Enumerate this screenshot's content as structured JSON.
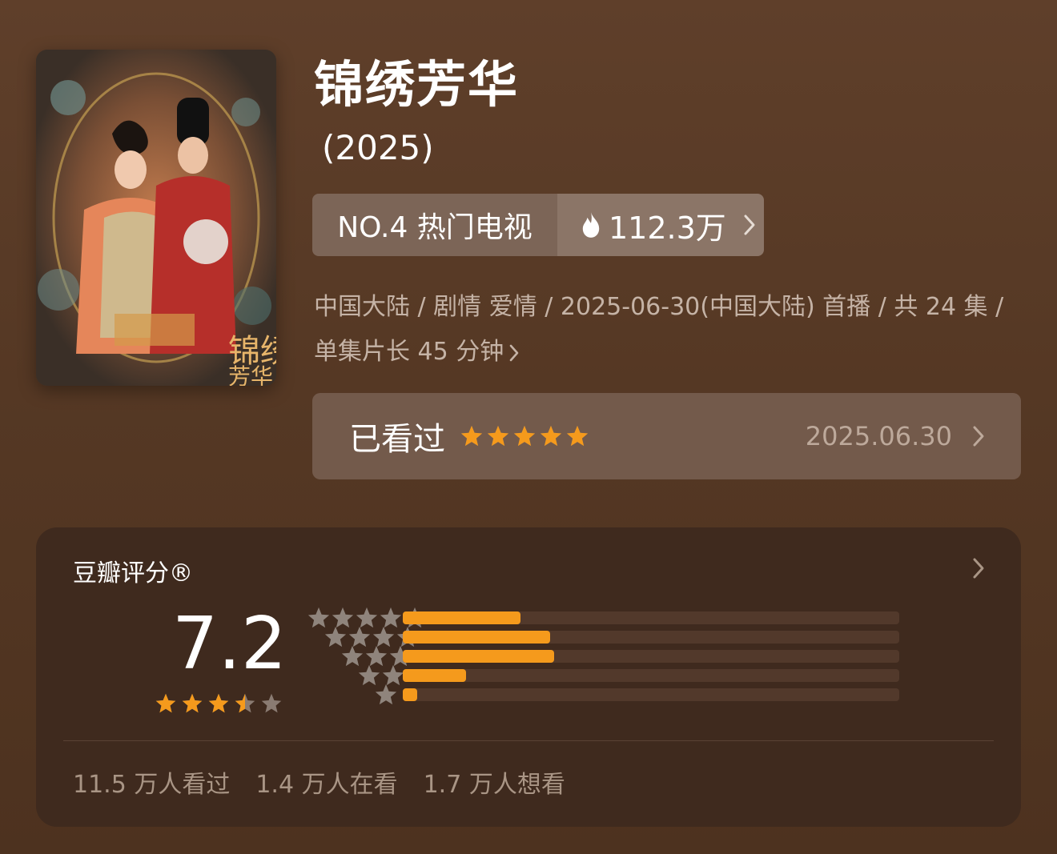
{
  "show": {
    "title": "锦绣芳华",
    "year": "(2025)",
    "poster_icon": "poster-image"
  },
  "rank": {
    "label": "NO.4 热门电视",
    "heat": "112.3万",
    "heat_icon": "flame-icon"
  },
  "meta": {
    "text": "中国大陆 / 剧情 爱情 / 2025-06-30(中国大陆) 首播 / 共 24 集 / 单集片长 45 分钟"
  },
  "watched": {
    "label": "已看过",
    "user_rating_stars": 5,
    "date": "2025.06.30"
  },
  "douban": {
    "title": "豆瓣评分®",
    "score": "7.2",
    "score_stars": 3.5,
    "distribution": [
      {
        "stars": 5,
        "fraction": 0.237
      },
      {
        "stars": 4,
        "fraction": 0.297
      },
      {
        "stars": 3,
        "fraction": 0.305
      },
      {
        "stars": 2,
        "fraction": 0.127
      },
      {
        "stars": 1,
        "fraction": 0.029
      }
    ],
    "counts": [
      "11.5 万人看过",
      "1.4 万人在看",
      "1.7 万人想看"
    ]
  },
  "colors": {
    "accent": "#f59a1c",
    "star_empty": "#8a7b72",
    "star_dist": "#8f847c"
  }
}
